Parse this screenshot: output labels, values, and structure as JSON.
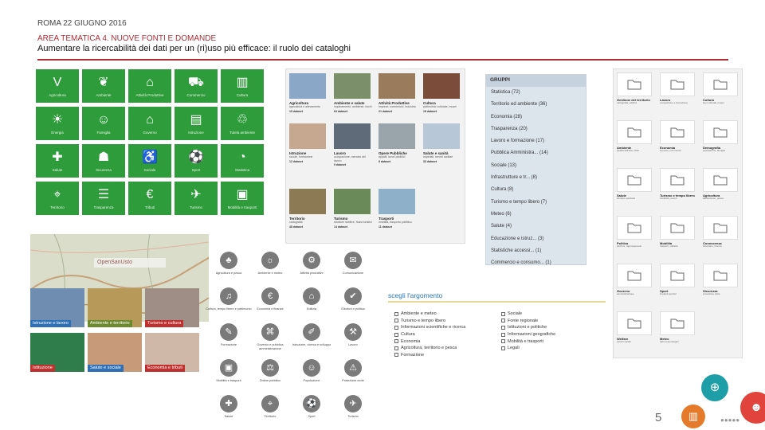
{
  "header": {
    "date": "ROMA 22 GIUGNO 2016",
    "area": "AREA TEMATICA 4. NUOVE FONTI E DOMANDE",
    "title": "Aumentare la ricercabilità dei dati per un (ri)uso più efficace: il ruolo dei cataloghi"
  },
  "colors": {
    "accent_red": "#b12d34",
    "tile_green": "#2e9c3a",
    "topic_blue": "#2776b8"
  },
  "green_tiles": [
    {
      "label": "Agricoltura",
      "icon": "leaf-v-icon",
      "glyph": "V"
    },
    {
      "label": "Ambiente",
      "icon": "leaf-icon",
      "glyph": "❦"
    },
    {
      "label": "Attività Produttive",
      "icon": "factory-icon",
      "glyph": "⌂"
    },
    {
      "label": "Commercio",
      "icon": "cart-icon",
      "glyph": "⛟"
    },
    {
      "label": "Cultura",
      "icon": "book-icon",
      "glyph": "▥"
    },
    {
      "label": "Energia",
      "icon": "bulb-icon",
      "glyph": "☀"
    },
    {
      "label": "Famiglia",
      "icon": "family-icon",
      "glyph": "☺"
    },
    {
      "label": "Governo",
      "icon": "building-icon",
      "glyph": "⌂"
    },
    {
      "label": "Istruzione",
      "icon": "books-icon",
      "glyph": "▤"
    },
    {
      "label": "Tutela ambiente",
      "icon": "eco-icon",
      "glyph": "♲"
    },
    {
      "label": "Salute",
      "icon": "cross-icon",
      "glyph": "✚"
    },
    {
      "label": "Sicurezza",
      "icon": "shield-icon",
      "glyph": "☗"
    },
    {
      "label": "Sociale",
      "icon": "wheelchair-icon",
      "glyph": "♿"
    },
    {
      "label": "Sport",
      "icon": "ball-icon",
      "glyph": "⚽"
    },
    {
      "label": "Statistica",
      "icon": "chart-icon",
      "glyph": "◔"
    },
    {
      "label": "Territorio",
      "icon": "map-icon",
      "glyph": "⌖"
    },
    {
      "label": "Trasparenza",
      "icon": "doc-icon",
      "glyph": "☰"
    },
    {
      "label": "Tributi",
      "icon": "money-icon",
      "glyph": "€"
    },
    {
      "label": "Turismo",
      "icon": "suitcase-icon",
      "glyph": "✈"
    },
    {
      "label": "Mobilità e trasporti",
      "icon": "bus-icon",
      "glyph": "▣"
    }
  ],
  "photo_cards": [
    {
      "title": "Agricoltura",
      "desc": "agricoltura e allevamento",
      "count": "15 dataset",
      "bg": "#8aa7c7"
    },
    {
      "title": "Ambiente e salute",
      "desc": "inquinamento, ambiente, rischi",
      "count": "64 dataset",
      "bg": "#7a8f6a"
    },
    {
      "title": "Attività Produttive",
      "desc": "imprese, commercio, industria",
      "count": "21 dataset",
      "bg": "#9a7b5c"
    },
    {
      "title": "Cultura",
      "desc": "patrimonio culturale, musei",
      "count": "18 dataset",
      "bg": "#7b4c3a"
    },
    {
      "title": "Istruzione",
      "desc": "scuole, formazione",
      "count": "12 dataset",
      "bg": "#c6a890"
    },
    {
      "title": "Lavoro",
      "desc": "occupazione, mercato del lavoro",
      "count": "9 dataset",
      "bg": "#5f6b78"
    },
    {
      "title": "Opere Pubbliche",
      "desc": "appalti, lavori pubblici",
      "count": "8 dataset",
      "bg": "#9aa4ab"
    },
    {
      "title": "Salute e sanità",
      "desc": "ospedali, servizi sanitari",
      "count": "33 dataset",
      "bg": "#b8c7d8"
    },
    {
      "title": "Territorio",
      "desc": "cartografia",
      "count": "48 dataset",
      "bg": "#8c7a55"
    },
    {
      "title": "Turismo",
      "desc": "strutture ricettive, flussi turistici",
      "count": "14 dataset",
      "bg": "#6b8a5a"
    },
    {
      "title": "Trasporti",
      "desc": "mobilità, trasporto pubblico",
      "count": "11 dataset",
      "bg": "#8fb0c9"
    }
  ],
  "groups": {
    "heading": "GRUPPI",
    "items": [
      "Statistica (72)",
      "Territorio ed ambiente (36)",
      "Economia (28)",
      "Trasparenza (20)",
      "Lavoro e formazione (17)",
      "Pubblica Amministra... (14)",
      "Sociale (13)",
      "Infrastrutture e tr... (8)",
      "Cultura (8)",
      "Turismo e tempo libero (7)",
      "Meteo (6)",
      "Salute (4)",
      "Educazione e istruz... (3)",
      "Statistiche accessi... (1)",
      "Commercio e consumo... (1)"
    ]
  },
  "folders": [
    {
      "title": "Gestione del territorio",
      "desc": "cartografia, edilizia"
    },
    {
      "title": "Lavoro",
      "desc": "occupazione e formazione"
    },
    {
      "title": "Cultura",
      "desc": "beni culturali, musei"
    },
    {
      "title": "Ambiente",
      "desc": "qualità dell'aria, rifiuti"
    },
    {
      "title": "Economia",
      "desc": "imprese, commercio"
    },
    {
      "title": "Demografia",
      "desc": "popolazione, famiglie"
    },
    {
      "title": "Salute",
      "desc": "strutture sanitarie"
    },
    {
      "title": "Turismo e tempo libero",
      "desc": "ricettività, eventi"
    },
    {
      "title": "Agricoltura",
      "desc": "allevamento, pesca"
    },
    {
      "title": "Politica",
      "desc": "elezioni, rappresentanti"
    },
    {
      "title": "Mobilità",
      "desc": "trasporti, viabilità"
    },
    {
      "title": "Conoscenza",
      "desc": "istruzione, ricerca"
    },
    {
      "title": "Governo",
      "desc": "amministrazione"
    },
    {
      "title": "Sport",
      "desc": "impianti sportivi"
    },
    {
      "title": "Sicurezza",
      "desc": "protezione civile"
    },
    {
      "title": "Welfare",
      "desc": "servizi sociali"
    },
    {
      "title": "Meteo",
      "desc": "dati meteorologici"
    }
  ],
  "map_banner": {
    "label": "OpenSanUsto"
  },
  "image_tiles": [
    {
      "caption": "Istruzione e lavoro",
      "bg": "#6f8db0",
      "capbg": "#2e6fb5"
    },
    {
      "caption": "Ambiente e territorio",
      "bg": "#b79a5a",
      "capbg": "#6d8a2f"
    },
    {
      "caption": "Turismo e cultura",
      "bg": "#9e8e86",
      "capbg": "#c0302e"
    },
    {
      "caption": "Istituzione",
      "bg": "#2f7d4a",
      "capbg": "#c0302e"
    },
    {
      "caption": "Salute e sociale",
      "bg": "#c79a7a",
      "capbg": "#2e6fb5"
    },
    {
      "caption": "Economia e tributi",
      "bg": "#d0b8a8",
      "capbg": "#c0302e"
    }
  ],
  "line_icons": [
    {
      "label": "Agricoltura e pesca",
      "glyph": "♣"
    },
    {
      "label": "Ambiente e meteo",
      "glyph": "☼"
    },
    {
      "label": "Attività produttive",
      "glyph": "⚙"
    },
    {
      "label": "Comunicazione",
      "glyph": "✉"
    },
    {
      "label": "Cultura, tempo libero e patrimonio",
      "glyph": "♫"
    },
    {
      "label": "Economia e finanze",
      "glyph": "€"
    },
    {
      "label": "Edilizia",
      "glyph": "⌂"
    },
    {
      "label": "Elezioni e politica",
      "glyph": "✔"
    },
    {
      "label": "Formazione",
      "glyph": "✎"
    },
    {
      "label": "Governo e pubblica amministrazione",
      "glyph": "⌘"
    },
    {
      "label": "Istruzione, ricerca e sviluppo",
      "glyph": "✐"
    },
    {
      "label": "Lavoro",
      "glyph": "⚒"
    },
    {
      "label": "Mobilità e trasporti",
      "glyph": "▣"
    },
    {
      "label": "Ordine pubblico",
      "glyph": "⚖"
    },
    {
      "label": "Popolazione",
      "glyph": "☺"
    },
    {
      "label": "Protezione civile",
      "glyph": "⚠"
    },
    {
      "label": "Salute",
      "glyph": "✚"
    },
    {
      "label": "Territorio",
      "glyph": "⌖"
    },
    {
      "label": "Sport",
      "glyph": "⚽"
    },
    {
      "label": "Turismo",
      "glyph": "✈"
    }
  ],
  "topics": {
    "heading": "scegli l'argomento",
    "left": [
      "Ambiente e meteo",
      "Turismo e tempo libero",
      "Informazioni scientifiche e ricerca",
      "Cultura",
      "Economia",
      "Agricoltura, territorio e pesca",
      "Formazione"
    ],
    "right": [
      "Sociale",
      "Fonte regionale",
      "Istituzioni e politiche",
      "Informazioni geografiche",
      "Mobilità e trasporti",
      "Legali"
    ]
  },
  "page_number": "5"
}
